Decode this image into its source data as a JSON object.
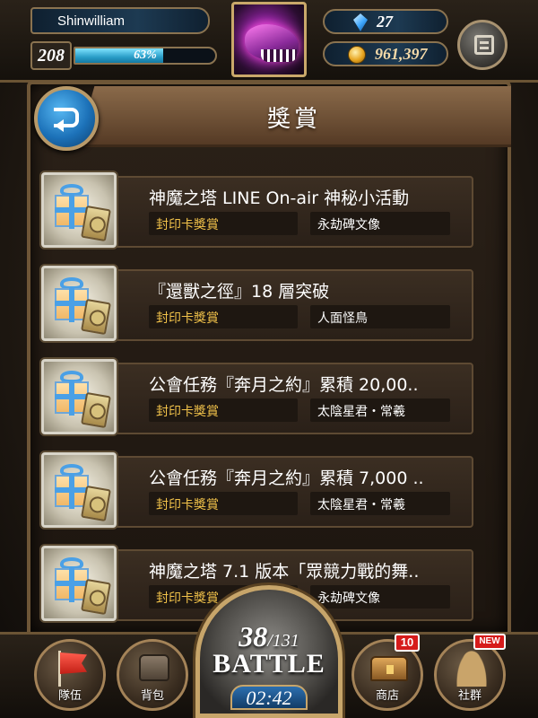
{
  "player": {
    "name": "Shinwilliam",
    "level": "208",
    "exp_percent": "63%",
    "exp_fraction": 0.63,
    "gems": "27",
    "coins": "961,397"
  },
  "header": {
    "title": "獎賞"
  },
  "rewards": [
    {
      "title": "神魔之塔 LINE On-air 神秘小活動",
      "type": "封印卡獎賞",
      "name": "永劫碑文像"
    },
    {
      "title": "『還獸之徑』18 層突破",
      "type": "封印卡獎賞",
      "name": "人面怪鳥"
    },
    {
      "title": "公會任務『奔月之約』累積 20,00..",
      "type": "封印卡獎賞",
      "name": "太陰星君・常羲"
    },
    {
      "title": "公會任務『奔月之約』累積 7,000 ..",
      "type": "封印卡獎賞",
      "name": "太陰星君・常羲"
    },
    {
      "title": "神魔之塔 7.1 版本「眾競力戰的舞..",
      "type": "封印卡獎賞",
      "name": "永劫碑文像"
    }
  ],
  "nav": {
    "team": "隊伍",
    "bag": "背包",
    "shop": "商店",
    "social": "社群",
    "shop_badge": "10",
    "social_badge": "NEW"
  },
  "battle": {
    "stamina_current": "38",
    "stamina_max": "/131",
    "label": "BATTLE",
    "timer": "02:42"
  },
  "colors": {
    "accent_blue": "#1c71b8",
    "gold_text": "#f1c24a",
    "badge_red": "#d61b1b"
  }
}
